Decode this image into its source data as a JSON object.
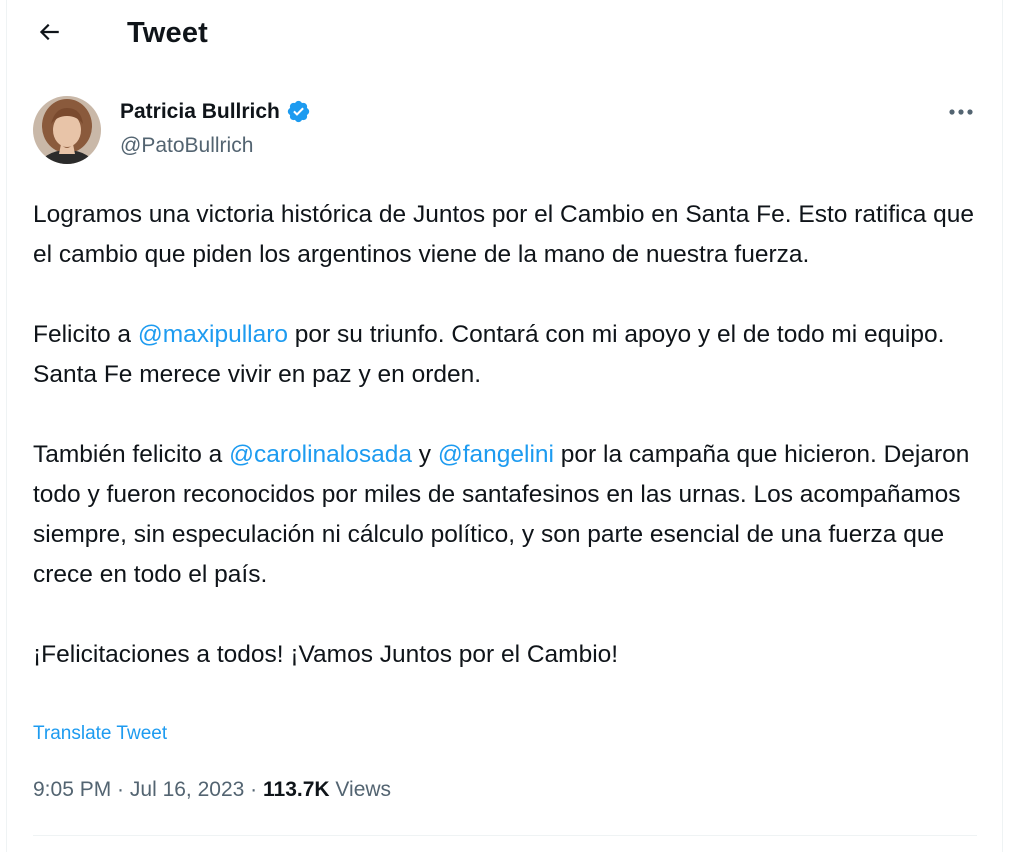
{
  "header": {
    "title": "Tweet",
    "back_icon": "arrow-left-icon"
  },
  "author": {
    "name": "Patricia Bullrich",
    "handle": "@PatoBullrich",
    "verified": true,
    "verified_color": "#1d9bf0"
  },
  "tweet": {
    "p1": "Logramos una victoria histórica de Juntos por el Cambio en Santa Fe. Esto ratifica que el cambio que piden los argentinos viene de la mano de nuestra fuerza.",
    "p2_a": "Felicito a ",
    "p2_mention": "@maxipullaro",
    "p2_b": " por su triunfo. Contará con mi apoyo y el de todo mi equipo. Santa Fe merece vivir en paz y en orden.",
    "p3_a": "También felicito a ",
    "p3_mention1": "@carolinalosada",
    "p3_b": " y ",
    "p3_mention2": "@fangelini",
    "p3_c": " por la campaña que hicieron. Dejaron todo y fueron reconocidos por miles de santafesinos en las urnas. Los acompañamos siempre, sin especulación ni cálculo político, y son parte esencial de una fuerza que crece en todo el país.",
    "p4": "¡Felicitaciones a todos! ¡Vamos Juntos por el Cambio!",
    "translate_label": "Translate Tweet"
  },
  "meta": {
    "time": "9:05 PM",
    "separator": " · ",
    "date": "Jul 16, 2023",
    "views_count": "113.7K",
    "views_label": " Views"
  },
  "colors": {
    "link": "#1d9bf0",
    "secondary_text": "#536471",
    "primary_text": "#0f1419"
  }
}
